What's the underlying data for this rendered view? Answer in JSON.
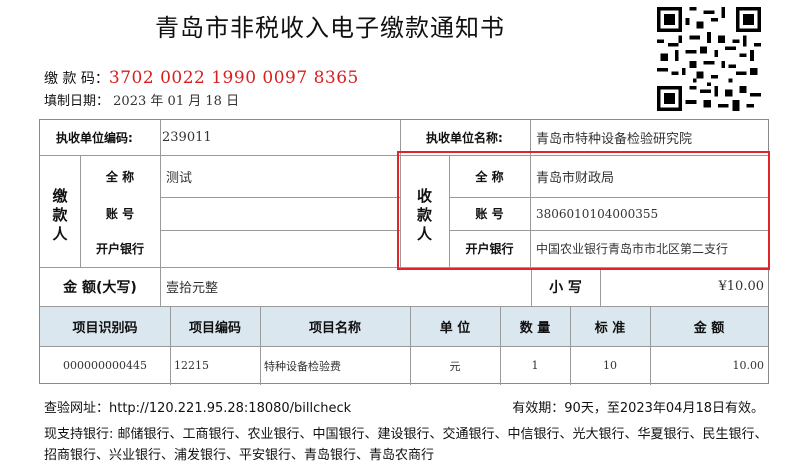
{
  "title": "青岛市非税收入电子缴款通知书",
  "payment_code": {
    "label": "缴 款 码：",
    "value": "3702 0022 1990 0097 8365"
  },
  "fill_date": {
    "label": "填制日期：",
    "year": "2023",
    "y": "年",
    "month": "01",
    "m": "月",
    "day": "18",
    "d": "日"
  },
  "collector": {
    "code_label": "执收单位编码:",
    "code_value": "239011",
    "name_label": "执收单位名称:",
    "name_value": "青岛市特种设备检验研究院"
  },
  "payer": {
    "section_label": "缴\n款\n人",
    "full_name_label": "全 称",
    "full_name_value": "测试",
    "account_label": "账 号",
    "account_value": "",
    "bank_label": "开户银行",
    "bank_value": ""
  },
  "payee": {
    "section_label": "收\n款\n人",
    "full_name_label": "全 称",
    "full_name_value": "青岛市财政局",
    "account_label": "账 号",
    "account_value": "3806010104000355",
    "bank_label": "开户银行",
    "bank_value": "中国农业银行青岛市市北区第二支行"
  },
  "amount": {
    "upper_label": "金 额(大写)",
    "upper_value": "壹拾元整",
    "lower_label": "小 写",
    "lower_value": "¥10.00"
  },
  "items_table": {
    "headers": [
      "项目识别码",
      "项目编码",
      "项目名称",
      "单 位",
      "数 量",
      "标 准",
      "金 额"
    ],
    "rows": [
      [
        "000000000445",
        "12215",
        "特种设备检验费",
        "元",
        "1",
        "10",
        "10.00"
      ]
    ]
  },
  "verify": "查验网址：http://120.221.95.28:18080/billcheck",
  "validity": "有效期：90天，至2023年04月18日有效。",
  "banks": "现支持银行: 邮储银行、工商银行、农业银行、中国银行、建设银行、交通银行、中信银行、光大银行、华夏银行、民生银行、招商银行、兴业银行、浦发银行、平安银行、青岛银行、青岛农商行",
  "colors": {
    "code_red": "#d81e1e",
    "highlight_red": "#e3232b",
    "header_band": "#dbe7ef"
  }
}
